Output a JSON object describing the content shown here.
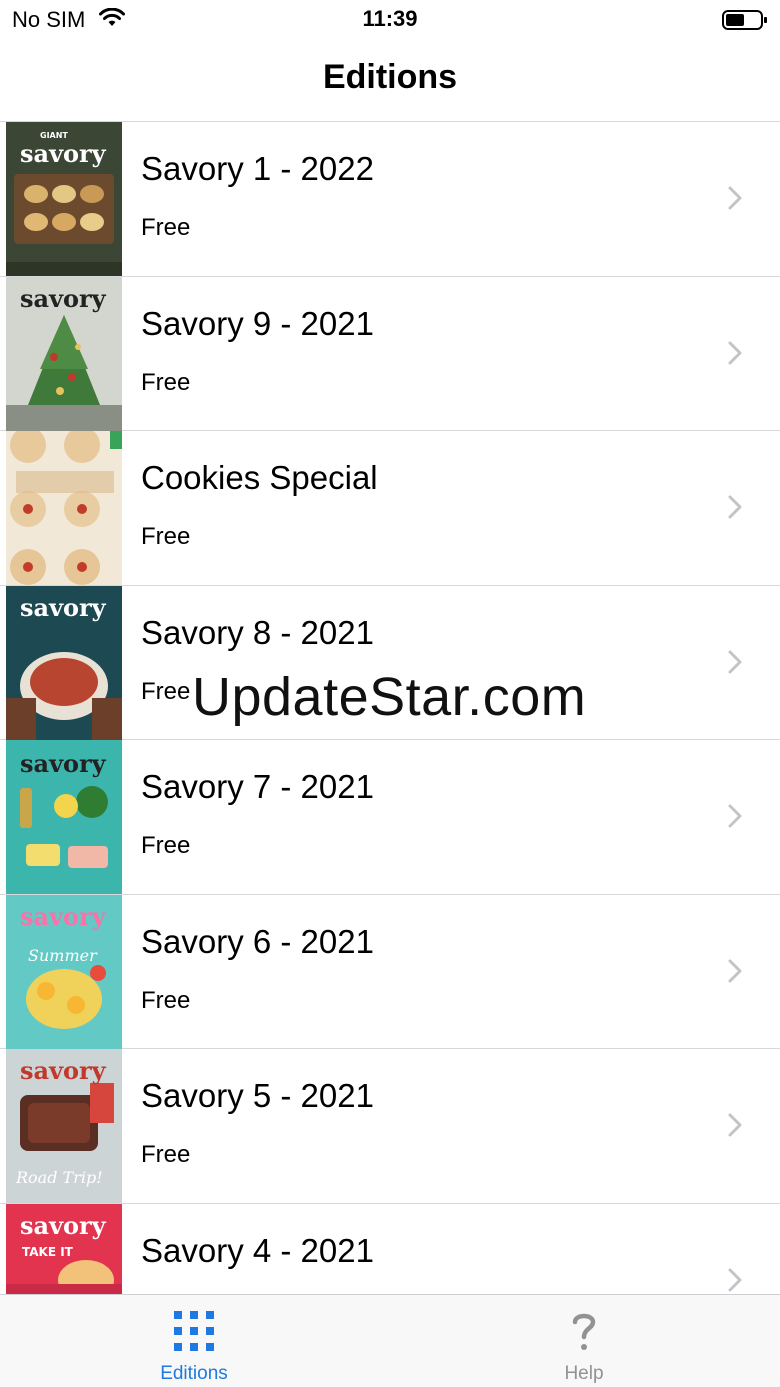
{
  "status_bar": {
    "carrier": "No SIM",
    "time": "11:39"
  },
  "header": {
    "title": "Editions"
  },
  "editions": [
    {
      "title": "Savory 1 - 2022",
      "price": "Free",
      "cover_color": "#3a4a33"
    },
    {
      "title": "Savory 9 - 2021",
      "price": "Free",
      "cover_color": "#c9ccc7"
    },
    {
      "title": "Cookies Special",
      "price": "Free",
      "cover_color": "#efe6d6"
    },
    {
      "title": "Savory 8 - 2021",
      "price": "Free",
      "cover_color": "#1f4e55"
    },
    {
      "title": "Savory 7 - 2021",
      "price": "Free",
      "cover_color": "#38b4ad"
    },
    {
      "title": "Savory 6 - 2021",
      "price": "Free",
      "cover_color": "#5ec7c3"
    },
    {
      "title": "Savory 5 - 2021",
      "price": "Free",
      "cover_color": "#cfd6d8"
    },
    {
      "title": "Savory 4 - 2021",
      "price": "",
      "cover_color": "#e0344d"
    }
  ],
  "watermark": "UpdateStar.com",
  "tab_bar": {
    "tabs": [
      {
        "label": "Editions",
        "icon": "grid-icon",
        "active": true
      },
      {
        "label": "Help",
        "icon": "question-mark-icon",
        "active": false
      }
    ]
  },
  "colors": {
    "accent": "#1f7ae0",
    "inactive": "#929292",
    "separator": "#d8d8dc"
  }
}
